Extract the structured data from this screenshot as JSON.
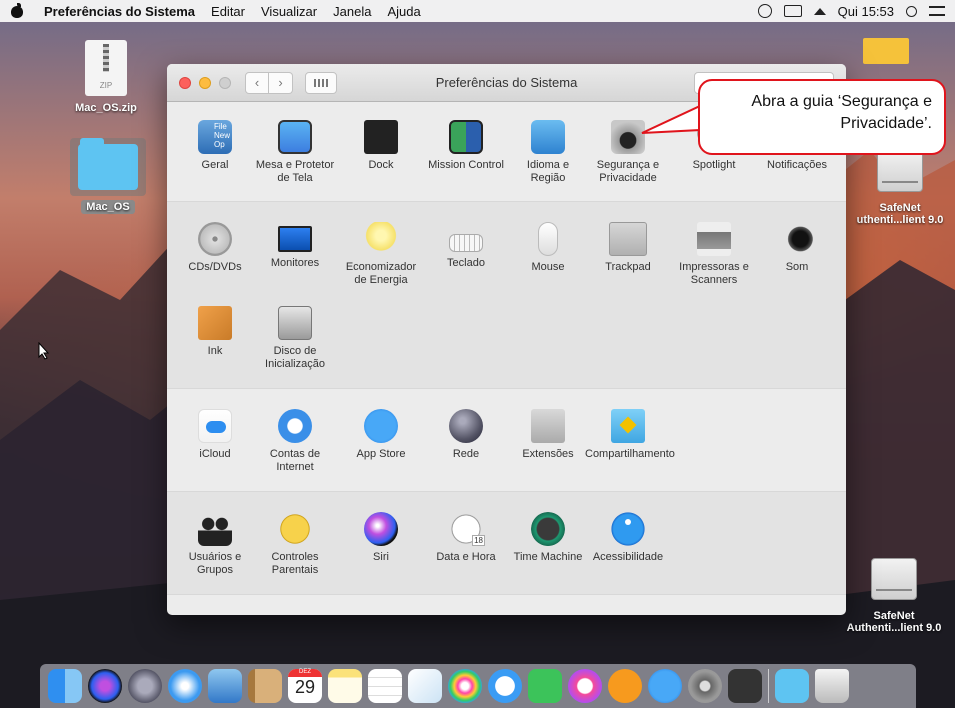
{
  "menubar": {
    "app_name": "Preferências do Sistema",
    "menus": [
      "Editar",
      "Visualizar",
      "Janela",
      "Ajuda"
    ],
    "clock": "Qui 15:53"
  },
  "desktop": {
    "zip_label": "Mac_OS.zip",
    "zip_icon_text": "ZIP",
    "folder_label": "Mac_OS",
    "drive1_label_line1": "SafeNet",
    "drive1_label_line2": "uthenti...lient 9.0",
    "drive2_label_line1": "SafeNet",
    "drive2_label_line2": "Authenti...lient 9.0"
  },
  "window": {
    "title": "Preferências do Sistema"
  },
  "sections": {
    "personal": [
      {
        "label": "Geral",
        "icon": "general-icon",
        "sub": [
          "File",
          "New",
          "Op"
        ]
      },
      {
        "label": "Mesa e Protetor de Tela",
        "icon": "desktop-screensaver-icon"
      },
      {
        "label": "Dock",
        "icon": "dock-icon"
      },
      {
        "label": "Mission Control",
        "icon": "mission-control-icon"
      },
      {
        "label": "Idioma e Região",
        "icon": "language-region-icon"
      },
      {
        "label": "Segurança e Privacidade",
        "icon": "security-privacy-icon"
      },
      {
        "label": "Spotlight",
        "icon": "spotlight-icon"
      },
      {
        "label": "Notificações",
        "icon": "notifications-icon"
      }
    ],
    "hardware": [
      {
        "label": "CDs/DVDs",
        "icon": "cd-dvd-icon"
      },
      {
        "label": "Monitores",
        "icon": "monitor-icon"
      },
      {
        "label": "Economizador de Energia",
        "icon": "energy-saver-icon"
      },
      {
        "label": "Teclado",
        "icon": "keyboard-icon"
      },
      {
        "label": "Mouse",
        "icon": "mouse-icon"
      },
      {
        "label": "Trackpad",
        "icon": "trackpad-icon"
      },
      {
        "label": "Impressoras e Scanners",
        "icon": "printer-icon"
      },
      {
        "label": "Som",
        "icon": "sound-icon"
      },
      {
        "label": "Ink",
        "icon": "ink-icon"
      },
      {
        "label": "Disco de Inicialização",
        "icon": "startup-disk-icon"
      }
    ],
    "internet": [
      {
        "label": "iCloud",
        "icon": "icloud-icon"
      },
      {
        "label": "Contas de Internet",
        "icon": "internet-accounts-icon"
      },
      {
        "label": "App Store",
        "icon": "app-store-icon"
      },
      {
        "label": "Rede",
        "icon": "network-icon"
      },
      {
        "label": "Extensões",
        "icon": "extensions-icon"
      },
      {
        "label": "Compartilhamento",
        "icon": "sharing-icon"
      }
    ],
    "system": [
      {
        "label": "Usuários e Grupos",
        "icon": "users-groups-icon"
      },
      {
        "label": "Controles Parentais",
        "icon": "parental-controls-icon"
      },
      {
        "label": "Siri",
        "icon": "siri-icon"
      },
      {
        "label": "Data e Hora",
        "icon": "date-time-icon",
        "badge": "18"
      },
      {
        "label": "Time Machine",
        "icon": "time-machine-icon"
      },
      {
        "label": "Acessibilidade",
        "icon": "accessibility-icon"
      }
    ]
  },
  "callout": {
    "text": "Abra a guia ‘Segurança e Privacidade’."
  },
  "dock": {
    "calendar_day": "29",
    "calendar_month": "DEZ"
  }
}
